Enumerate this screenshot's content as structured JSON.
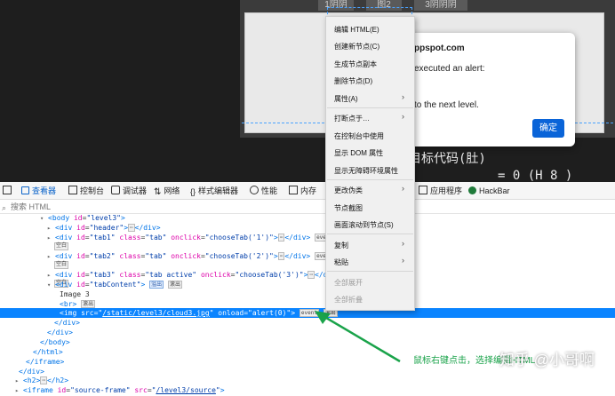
{
  "page": {
    "tabs": [
      "1阴阴",
      "图2",
      "3阴阴阴"
    ],
    "alert": {
      "title": "ppspot.com",
      "message1": "executed an alert:",
      "message2": "to the next level.",
      "ok_label": "确定"
    },
    "bg_text1": "目标代码(肚)",
    "bg_text2": "= 0 (H 8 )"
  },
  "toolbar": {
    "items": [
      {
        "label": "",
        "icon": "pick-element-icon"
      },
      {
        "label": "查看器",
        "icon": "inspector-icon"
      },
      {
        "label": "控制台",
        "icon": "console-icon"
      },
      {
        "label": "调试器",
        "icon": "debugger-icon"
      },
      {
        "label": "网络",
        "icon": "network-icon"
      },
      {
        "label": "样式编辑器",
        "icon": "style-editor-icon"
      },
      {
        "label": "性能",
        "icon": "performance-icon"
      },
      {
        "label": "内存",
        "icon": "memory-icon"
      },
      {
        "label": "应用程序",
        "icon": "application-icon"
      },
      {
        "label": "HackBar",
        "icon": "hackbar-icon"
      }
    ]
  },
  "search": {
    "placeholder": "搜索 HTML"
  },
  "tree": {
    "body": {
      "tag": "body",
      "id": "level3"
    },
    "header": {
      "tag": "div",
      "id": "header"
    },
    "tab1": {
      "tag": "div",
      "id": "tab1",
      "class": "tab",
      "onclick": "chooseTab('1')",
      "badge": "event",
      "sub": "空白"
    },
    "tab2": {
      "tag": "div",
      "id": "tab2",
      "class": "tab",
      "onclick": "chooseTab('2')",
      "badge": "event",
      "sub": "空白"
    },
    "tab3": {
      "tag": "div",
      "id": "tab3",
      "class": "tab active",
      "onclick": "chooseTab('3')",
      "badge": "event",
      "sub": "空白"
    },
    "tabContent": {
      "tag": "div",
      "id": "tabContent",
      "badge1": "溢出",
      "badge2": "滚出"
    },
    "image_text": "Image 3",
    "br": {
      "tag": "br",
      "badge": "滚出"
    },
    "img": {
      "tag": "img",
      "src": "/static/level3/cloud3.jpg",
      "onload": "alert(0)",
      "badge1": "event",
      "badge2": "滚出"
    },
    "close_div": "</div>",
    "close_div2": "</div>",
    "close_body": "</body>",
    "close_html": "</html>",
    "close_iframe": "</iframe>",
    "close_div3": "</div>",
    "h2": {
      "open": "<h2>",
      "close": "</h2>"
    },
    "iframe": {
      "tag": "iframe",
      "id": "source-frame",
      "src": "/level3/source"
    }
  },
  "context_menu": {
    "items": [
      {
        "label": "编辑 HTML(E)",
        "submenu": false,
        "disabled": false
      },
      {
        "label": "创建新节点(C)",
        "submenu": false,
        "disabled": false
      },
      {
        "label": "生成节点副本",
        "submenu": false,
        "disabled": false
      },
      {
        "label": "删除节点(D)",
        "submenu": false,
        "disabled": false
      },
      {
        "label": "属性(A)",
        "submenu": true,
        "disabled": false
      },
      {
        "label": "打断点于…",
        "submenu": true,
        "disabled": false
      },
      {
        "label": "在控制台中使用",
        "submenu": false,
        "disabled": false
      },
      {
        "label": "显示 DOM 属性",
        "submenu": false,
        "disabled": false
      },
      {
        "label": "显示无障碍环境属性",
        "submenu": false,
        "disabled": false
      },
      {
        "label": "更改伪类",
        "submenu": true,
        "disabled": false
      },
      {
        "label": "节点截图",
        "submenu": false,
        "disabled": false
      },
      {
        "label": "画面滚动到节点(S)",
        "submenu": false,
        "disabled": false
      },
      {
        "label": "复制",
        "submenu": true,
        "disabled": false
      },
      {
        "label": "粘贴",
        "submenu": true,
        "disabled": false
      },
      {
        "label": "全部展开",
        "submenu": false,
        "disabled": true
      },
      {
        "label": "全部折叠",
        "submenu": false,
        "disabled": true
      }
    ]
  },
  "annotation": {
    "text": "鼠标右键点击，选择编辑HTML",
    "watermark": "知乎 @小哥啊",
    "color": "#1aa34a"
  }
}
